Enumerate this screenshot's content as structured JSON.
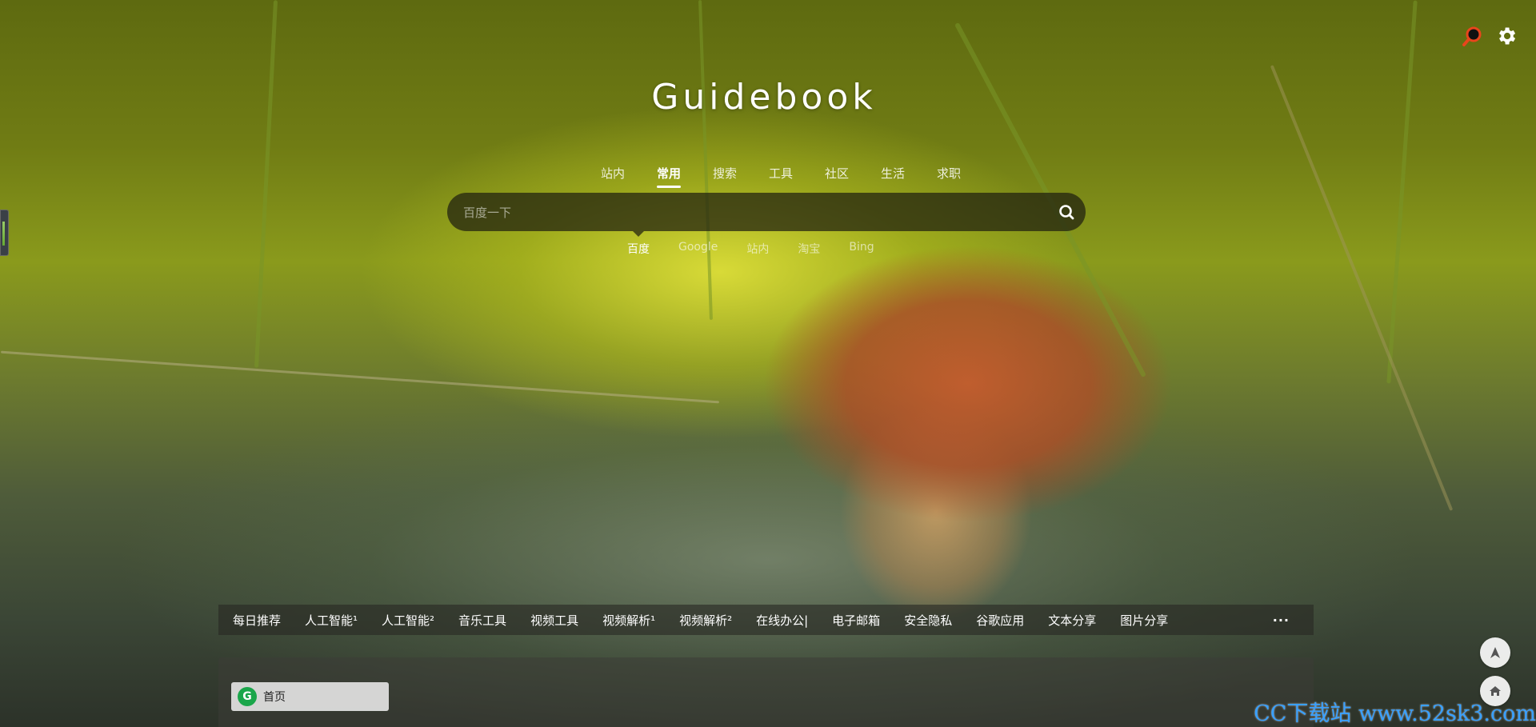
{
  "site": {
    "title": "Guidebook"
  },
  "top_icons": [
    "search-icon",
    "gear-icon"
  ],
  "category_tabs": [
    {
      "label": "站内",
      "active": false
    },
    {
      "label": "常用",
      "active": true
    },
    {
      "label": "搜索",
      "active": false
    },
    {
      "label": "工具",
      "active": false
    },
    {
      "label": "社区",
      "active": false
    },
    {
      "label": "生活",
      "active": false
    },
    {
      "label": "求职",
      "active": false
    }
  ],
  "search": {
    "placeholder": "百度一下",
    "value": ""
  },
  "engine_tabs": [
    {
      "label": "百度",
      "active": true
    },
    {
      "label": "Google",
      "active": false
    },
    {
      "label": "站内",
      "active": false
    },
    {
      "label": "淘宝",
      "active": false
    },
    {
      "label": "Bing",
      "active": false
    }
  ],
  "nav": {
    "items": [
      "每日推荐",
      "人工智能¹",
      "人工智能²",
      "音乐工具",
      "视频工具",
      "视频解析¹",
      "视频解析²",
      "在线办公|",
      "电子邮箱",
      "安全隐私",
      "谷歌应用",
      "文本分享",
      "图片分享"
    ],
    "more": "···"
  },
  "home": {
    "badge": "G",
    "label": "首页"
  },
  "watermark": "CC下载站 www.52sk3.com",
  "colors": {
    "home_badge": "#1aa64a",
    "watermark": "#39a0ff",
    "search_bg": "#1e1e0f"
  }
}
